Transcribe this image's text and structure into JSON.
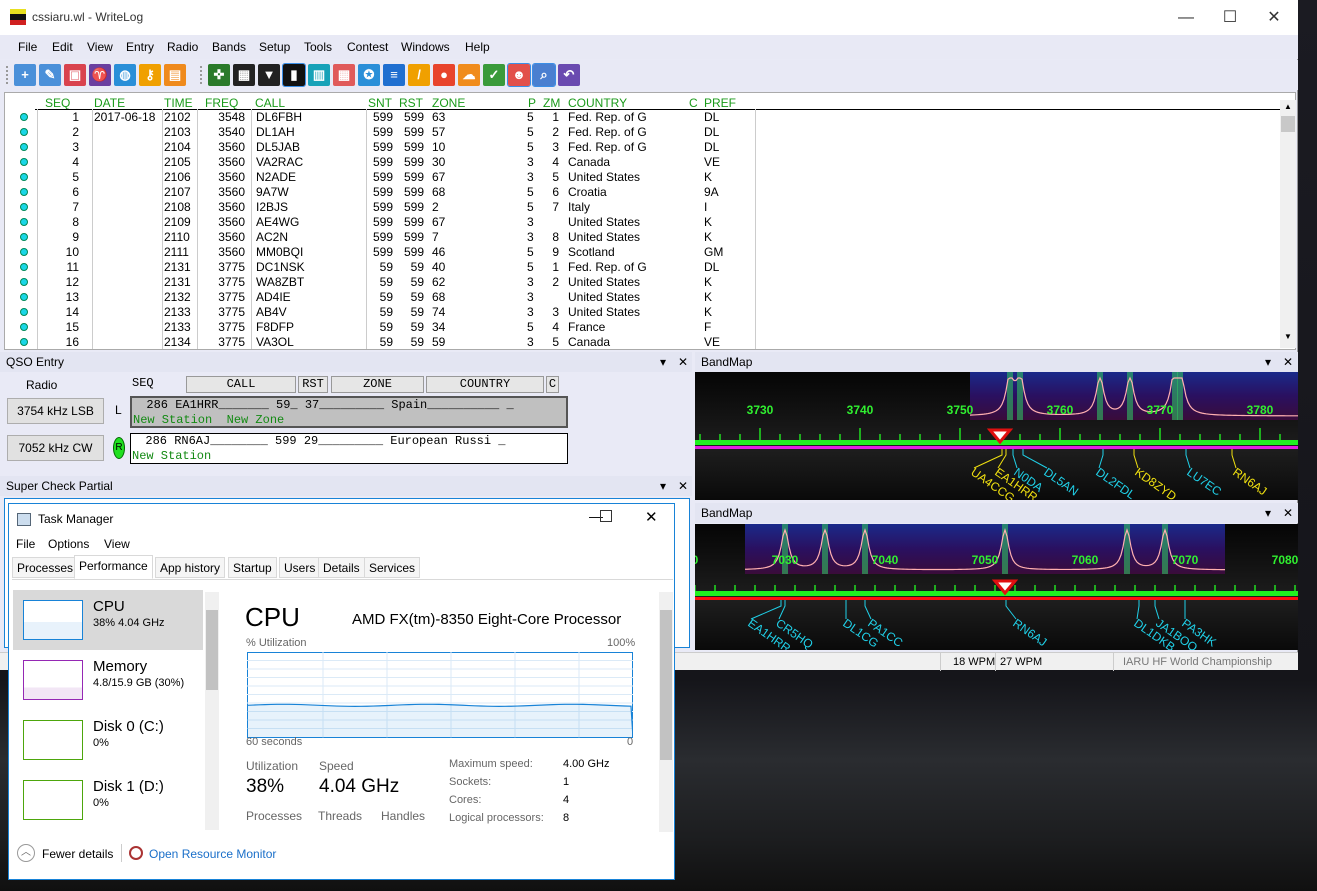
{
  "window": {
    "title": "cssiaru.wl - WriteLog",
    "controls": [
      "—",
      "☐",
      "✕"
    ]
  },
  "menu": [
    "File",
    "Edit",
    "View",
    "Entry",
    "Radio",
    "Bands",
    "Setup",
    "Tools",
    "Contest",
    "Windows",
    "Help"
  ],
  "toolbar": [
    {
      "icon": "new-file-icon",
      "color": "#4a90d9",
      "glyph": "+"
    },
    {
      "icon": "edit-file-icon",
      "color": "#4a90d9",
      "glyph": "✎"
    },
    {
      "icon": "save-icon",
      "color": "#d9434e",
      "glyph": "▣"
    },
    {
      "icon": "ram-icon",
      "color": "#6a3fa0",
      "glyph": "♈"
    },
    {
      "icon": "globe-icon",
      "color": "#2a8fd8",
      "glyph": "◍"
    },
    {
      "icon": "key-icon",
      "color": "#f0a000",
      "glyph": "⚷"
    },
    {
      "icon": "briefcase-icon",
      "color": "#ef8a1c",
      "glyph": "▤"
    },
    {
      "icon": "network-icon",
      "color": "#2a7a2a",
      "glyph": "✜"
    },
    {
      "icon": "packet-icon",
      "color": "#222",
      "glyph": "▦"
    },
    {
      "icon": "packet-spot-icon",
      "color": "#222",
      "glyph": "▼"
    },
    {
      "icon": "bandmap-icon",
      "color": "#111",
      "glyph": "▮"
    },
    {
      "icon": "bar-chart-icon",
      "color": "#17a2b8",
      "glyph": "▥"
    },
    {
      "icon": "calendar-icon",
      "color": "#e05a5a",
      "glyph": "▦"
    },
    {
      "icon": "compass-icon",
      "color": "#2a8fd8",
      "glyph": "✪"
    },
    {
      "icon": "list-icon",
      "color": "#1f6fd0",
      "glyph": "≡"
    },
    {
      "icon": "pencil-icon",
      "color": "#f0a000",
      "glyph": "/"
    },
    {
      "icon": "map-pin-icon",
      "color": "#e8442c",
      "glyph": "●"
    },
    {
      "icon": "cloud-icon",
      "color": "#f08c1c",
      "glyph": "☁"
    },
    {
      "icon": "checklist-icon",
      "color": "#3a9a3a",
      "glyph": "✓"
    },
    {
      "icon": "operator-icon",
      "color": "#e2504a",
      "glyph": "☻"
    },
    {
      "icon": "window-search-icon",
      "color": "#4a7fd0",
      "glyph": "⌕"
    },
    {
      "icon": "undo-icon",
      "color": "#6a4ab0",
      "glyph": "↶"
    }
  ],
  "log": {
    "headers": [
      "SEQ",
      "DATE",
      "TIME",
      "FREQ",
      "CALL",
      "SNT",
      "RST",
      "ZONE",
      "P",
      "ZM",
      "COUNTRY",
      "C",
      "PREF"
    ],
    "rows": [
      [
        "1",
        "2017-06-18",
        "2102",
        "3548",
        "DL6FBH",
        "599",
        "599",
        "63",
        "5",
        "1",
        "Fed. Rep. of G",
        "",
        "DL"
      ],
      [
        "2",
        "",
        "2103",
        "3540",
        "DL1AH",
        "599",
        "599",
        "57",
        "5",
        "2",
        "Fed. Rep. of G",
        "",
        "DL"
      ],
      [
        "3",
        "",
        "2104",
        "3560",
        "DL5JAB",
        "599",
        "599",
        "10",
        "5",
        "3",
        "Fed. Rep. of G",
        "",
        "DL"
      ],
      [
        "4",
        "",
        "2105",
        "3560",
        "VA2RAC",
        "599",
        "599",
        "30",
        "3",
        "4",
        "Canada",
        "",
        "VE"
      ],
      [
        "5",
        "",
        "2106",
        "3560",
        "N2ADE",
        "599",
        "599",
        "67",
        "3",
        "5",
        "United States",
        "",
        "K"
      ],
      [
        "6",
        "",
        "2107",
        "3560",
        "9A7W",
        "599",
        "599",
        "68",
        "5",
        "6",
        "Croatia",
        "",
        "9A"
      ],
      [
        "7",
        "",
        "2108",
        "3560",
        "I2BJS",
        "599",
        "599",
        "2",
        "5",
        "7",
        "Italy",
        "",
        "I"
      ],
      [
        "8",
        "",
        "2109",
        "3560",
        "AE4WG",
        "599",
        "599",
        "67",
        "3",
        "",
        "United States",
        "",
        "K"
      ],
      [
        "9",
        "",
        "2110",
        "3560",
        "AC2N",
        "599",
        "599",
        "7",
        "3",
        "8",
        "United States",
        "",
        "K"
      ],
      [
        "10",
        "",
        "2111",
        "3560",
        "MM0BQI",
        "599",
        "599",
        "46",
        "5",
        "9",
        "Scotland",
        "",
        "GM"
      ],
      [
        "11",
        "",
        "2131",
        "3775",
        "DC1NSK",
        "59",
        "59",
        "40",
        "5",
        "1",
        "Fed. Rep. of G",
        "",
        "DL"
      ],
      [
        "12",
        "",
        "2131",
        "3775",
        "WA8ZBT",
        "59",
        "59",
        "62",
        "3",
        "2",
        "United States",
        "",
        "K"
      ],
      [
        "13",
        "",
        "2132",
        "3775",
        "AD4IE",
        "59",
        "59",
        "68",
        "3",
        "",
        "United States",
        "",
        "K"
      ],
      [
        "14",
        "",
        "2133",
        "3775",
        "AB4V",
        "59",
        "59",
        "74",
        "3",
        "3",
        "United States",
        "",
        "K"
      ],
      [
        "15",
        "",
        "2133",
        "3775",
        "F8DFP",
        "59",
        "59",
        "34",
        "5",
        "4",
        "France",
        "",
        "F"
      ],
      [
        "16",
        "",
        "2134",
        "3775",
        "VA3OL",
        "59",
        "59",
        "59",
        "3",
        "5",
        "Canada",
        "",
        "VE"
      ]
    ]
  },
  "qso_entry": {
    "title": "QSO Entry",
    "radio_label": "Radio",
    "radio1": "3754 kHz LSB",
    "radio1_side": "L",
    "radio2": "7052 kHz CW",
    "radio2_badge": "R",
    "columns": [
      "SEQ",
      "CALL",
      "RST",
      "ZONE",
      "COUNTRY",
      "C"
    ],
    "line1": "  286 EA1HRR_______ 59_ 37_________ Spain__________ _",
    "line1_status": "New Station  New Zone",
    "line2": "  286 RN6AJ________ 599 29_________ European Russi _",
    "line2_status": "New Station",
    "status_color": "#138a13"
  },
  "super_check": {
    "title": "Super Check Partial"
  },
  "panel_controls": {
    "menu": "▾",
    "close": "✕"
  },
  "bandmap1": {
    "title": "BandMap",
    "range": [
      3723.5,
      3783.8
    ],
    "ticks": [
      3730,
      3740,
      3750,
      3760,
      3770,
      3780
    ],
    "cursor": 3754,
    "lower_line": "#e020e0",
    "spots": [
      {
        "call": "UA4CCG",
        "f": 3754.2,
        "color": "#f0e010"
      },
      {
        "call": "EA1HRR",
        "f": 3754.6,
        "color": "#f0e010"
      },
      {
        "call": "N0DA",
        "f": 3755.3,
        "color": "#20d0e8"
      },
      {
        "call": "DL5AN",
        "f": 3756.3,
        "color": "#20d0e8"
      },
      {
        "call": "DL2FDL",
        "f": 3764.3,
        "color": "#20d0e8"
      },
      {
        "call": "KD8ZYD",
        "f": 3767.4,
        "color": "#f0e010"
      },
      {
        "call": "LU7EC",
        "f": 3772.6,
        "color": "#20d0e8"
      },
      {
        "call": "RN6AJ",
        "f": 3777.2,
        "color": "#f0e010"
      }
    ]
  },
  "bandmap2": {
    "title": "BandMap",
    "range": [
      7021,
      7081.3
    ],
    "ticks": [
      7020,
      7030,
      7040,
      7050,
      7060,
      7070,
      7080
    ],
    "cursor": 7052,
    "lower_line": "#ff1010",
    "spots": [
      {
        "call": "EA1HRR",
        "f": 7029.6,
        "color": "#20d0e8"
      },
      {
        "call": "CR5HQ",
        "f": 7030.0,
        "color": "#20d0e8"
      },
      {
        "call": "DL1CG",
        "f": 7036.1,
        "color": "#20d0e8"
      },
      {
        "call": "PA1CC",
        "f": 7038.0,
        "color": "#20d0e8"
      },
      {
        "call": "RN6AJ",
        "f": 7052.1,
        "color": "#20d0e8"
      },
      {
        "call": "DL1DKB",
        "f": 7065.4,
        "color": "#20d0e8"
      },
      {
        "call": "JA1BOQ",
        "f": 7067.0,
        "color": "#20d0e8"
      },
      {
        "call": "PA3HK",
        "f": 7070.0,
        "color": "#20d0e8"
      }
    ]
  },
  "statusbar": {
    "wpm1": "18 WPM",
    "wpm2": "27 WPM",
    "contest": "IARU HF World Championship"
  },
  "taskmgr": {
    "title": "Task Manager",
    "menu": [
      "File",
      "Options",
      "View"
    ],
    "tabs": [
      "Processes",
      "Performance",
      "App history",
      "Startup",
      "Users",
      "Details",
      "Services"
    ],
    "active_tab": "Performance",
    "side": [
      {
        "name": "CPU",
        "value": "38% 4.04 GHz",
        "color": "#1883d7"
      },
      {
        "name": "Memory",
        "value": "4.8/15.9 GB (30%)",
        "color": "#9528b4"
      },
      {
        "name": "Disk 0 (C:)",
        "value": "0%",
        "color": "#4da60c"
      },
      {
        "name": "Disk 1 (D:)",
        "value": "0%",
        "color": "#4da60c"
      }
    ],
    "heading": "CPU",
    "processor": "AMD FX(tm)-8350 Eight-Core Processor",
    "graph_label": "% Utilization",
    "graph_max": "100%",
    "graph_time": "60 seconds",
    "graph_min": "0",
    "utilization_percent": 38,
    "stats": {
      "util_label": "Utilization",
      "util": "38%",
      "speed_label": "Speed",
      "speed": "4.04 GHz",
      "processes_label": "Processes",
      "threads_label": "Threads",
      "handles_label": "Handles"
    },
    "specs": [
      [
        "Maximum speed:",
        "4.00 GHz"
      ],
      [
        "Sockets:",
        "1"
      ],
      [
        "Cores:",
        "4"
      ],
      [
        "Logical processors:",
        "8"
      ]
    ],
    "fewer_details": "Fewer details",
    "resource_monitor": "Open Resource Monitor"
  }
}
